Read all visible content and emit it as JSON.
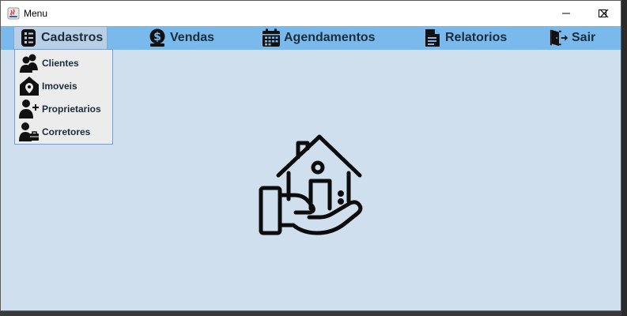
{
  "window": {
    "title": "Menu",
    "background_color": "#cfdfee",
    "menubar_color": "#7ab9eb"
  },
  "controls": {
    "minimize_icon": "minimize-icon",
    "maximize_icon": "maximize-icon",
    "close_icon": "close-icon"
  },
  "menubar": {
    "items": [
      {
        "label": "Cadastros",
        "icon": "list-icon",
        "active": true
      },
      {
        "label": "Vendas",
        "icon": "dollar-icon"
      },
      {
        "label": "Agendamentos",
        "icon": "calendar-icon"
      },
      {
        "label": "Relatorios",
        "icon": "document-icon"
      },
      {
        "label": "Sair",
        "icon": "exit-door-icon"
      }
    ]
  },
  "dropdown": {
    "items": [
      {
        "label": "Clientes",
        "icon": "users-icon"
      },
      {
        "label": "Imoveis",
        "icon": "house-pin-icon"
      },
      {
        "label": "Proprietarios",
        "icon": "user-add-icon"
      },
      {
        "label": "Corretores",
        "icon": "user-briefcase-icon"
      }
    ]
  },
  "main": {
    "logo": "house-in-hand-icon"
  }
}
